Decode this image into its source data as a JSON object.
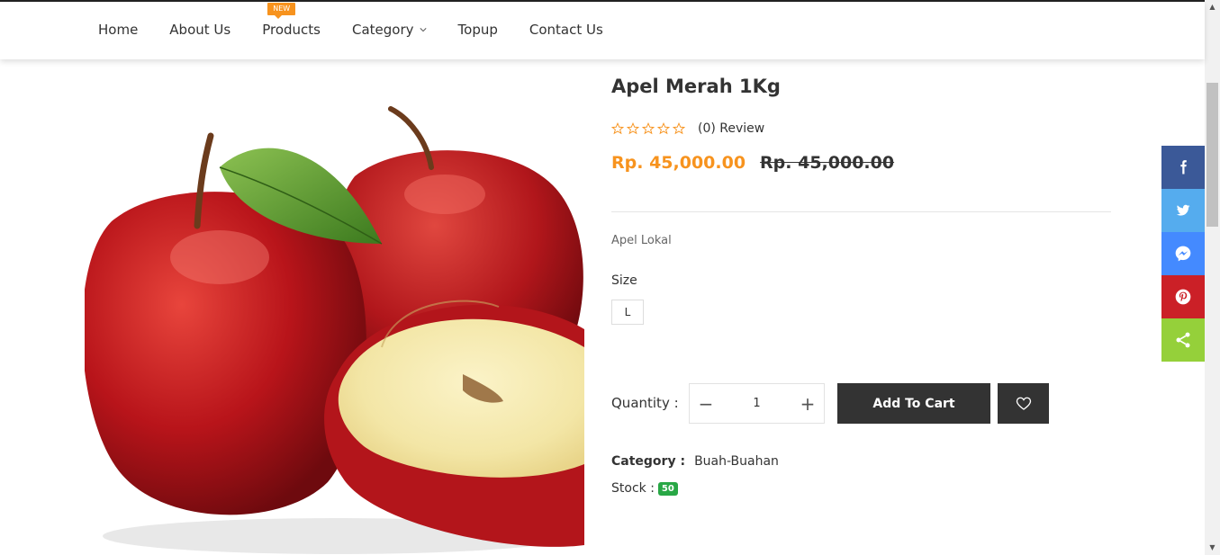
{
  "nav": {
    "items": [
      {
        "label": "Home"
      },
      {
        "label": "About Us"
      },
      {
        "label": "Products",
        "badge": "NEW"
      },
      {
        "label": "Category"
      },
      {
        "label": "Topup"
      },
      {
        "label": "Contact Us"
      }
    ]
  },
  "product": {
    "title": "Apel Merah 1Kg",
    "rating_stars": 0,
    "review": "(0) Review",
    "price": "Rp. 45,000.00",
    "old_price": "Rp. 45,000.00",
    "description": "Apel Lokal",
    "size_label": "Size",
    "size_option": "L",
    "quantity_label": "Quantity :",
    "quantity": "1",
    "qty_minus": "−",
    "qty_plus": "+",
    "add_to_cart": "Add To Cart",
    "category_label": "Category :",
    "category_value": "Buah-Buahan",
    "stock_label": "Stock :",
    "stock_value": "50"
  },
  "share": [
    {
      "icon": "facebook-icon",
      "color": "#3b5998"
    },
    {
      "icon": "twitter-icon",
      "color": "#55acee"
    },
    {
      "icon": "messenger-icon",
      "color": "#448aff"
    },
    {
      "icon": "pinterest-icon",
      "color": "#cb2027"
    },
    {
      "icon": "share-icon",
      "color": "#95d03a"
    }
  ],
  "colors": {
    "accent": "#f7931e",
    "dark_button": "#333333",
    "stock_badge": "#28a745"
  }
}
